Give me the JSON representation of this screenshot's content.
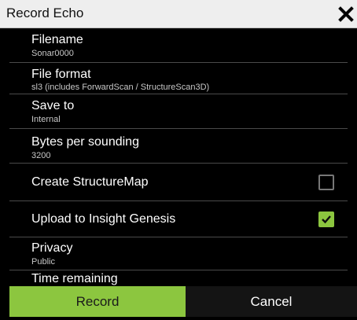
{
  "dialog": {
    "title": "Record Echo",
    "close_icon": "close-icon"
  },
  "rows": [
    {
      "label": "Filename",
      "value": "Sonar0000"
    },
    {
      "label": "File format",
      "value": "sl3 (includes ForwardScan / StructureScan3D)"
    },
    {
      "label": "Save to",
      "value": "Internal"
    },
    {
      "label": "Bytes per sounding",
      "value": "3200"
    },
    {
      "label": "Create StructureMap",
      "checked": false
    },
    {
      "label": "Upload to Insight Genesis",
      "checked": true
    },
    {
      "label": "Privacy",
      "value": "Public"
    },
    {
      "label": "Time remaining"
    }
  ],
  "buttons": {
    "record": "Record",
    "cancel": "Cancel"
  },
  "colors": {
    "accent": "#8cc63f",
    "background": "#000000",
    "titlebar": "#eeeeee"
  }
}
